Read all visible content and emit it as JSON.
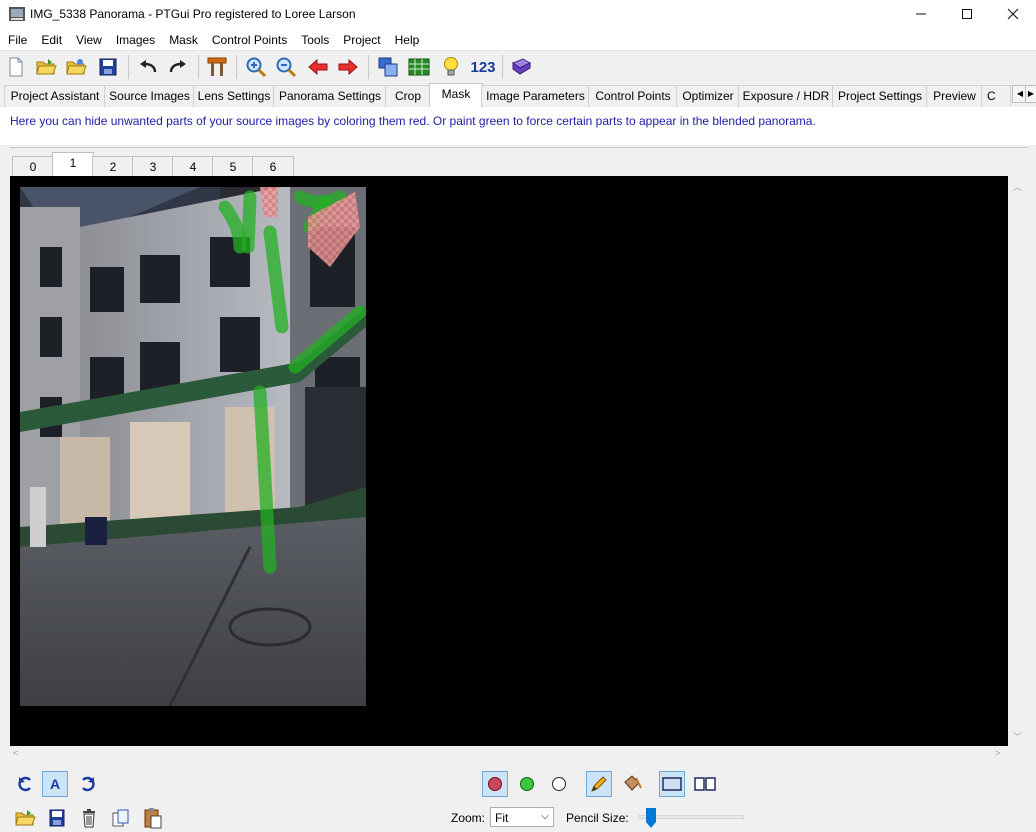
{
  "window": {
    "title": "IMG_5338 Panorama - PTGui Pro registered to Loree Larson"
  },
  "menu": [
    "File",
    "Edit",
    "View",
    "Images",
    "Mask",
    "Control Points",
    "Tools",
    "Project",
    "Help"
  ],
  "toolbar": {
    "number_label": "123"
  },
  "tabs": [
    "Project Assistant",
    "Source Images",
    "Lens Settings",
    "Panorama Settings",
    "Crop",
    "Mask",
    "Image Parameters",
    "Control Points",
    "Optimizer",
    "Exposure / HDR",
    "Project Settings",
    "Preview",
    "C"
  ],
  "active_tab": "Mask",
  "info_text": "Here you can hide unwanted parts of your source images by coloring them red. Or paint green to force certain parts to appear in the blended panorama.",
  "image_tabs": [
    "0",
    "1",
    "2",
    "3",
    "4",
    "5",
    "6"
  ],
  "active_image_tab": "1",
  "zoom": {
    "label": "Zoom:",
    "value": "Fit"
  },
  "pencil": {
    "label": "Pencil Size:",
    "level": 0.08
  },
  "colors": {
    "mask_red": "#e05050",
    "mask_green": "#22b022",
    "info_text": "#1c1ca8"
  }
}
